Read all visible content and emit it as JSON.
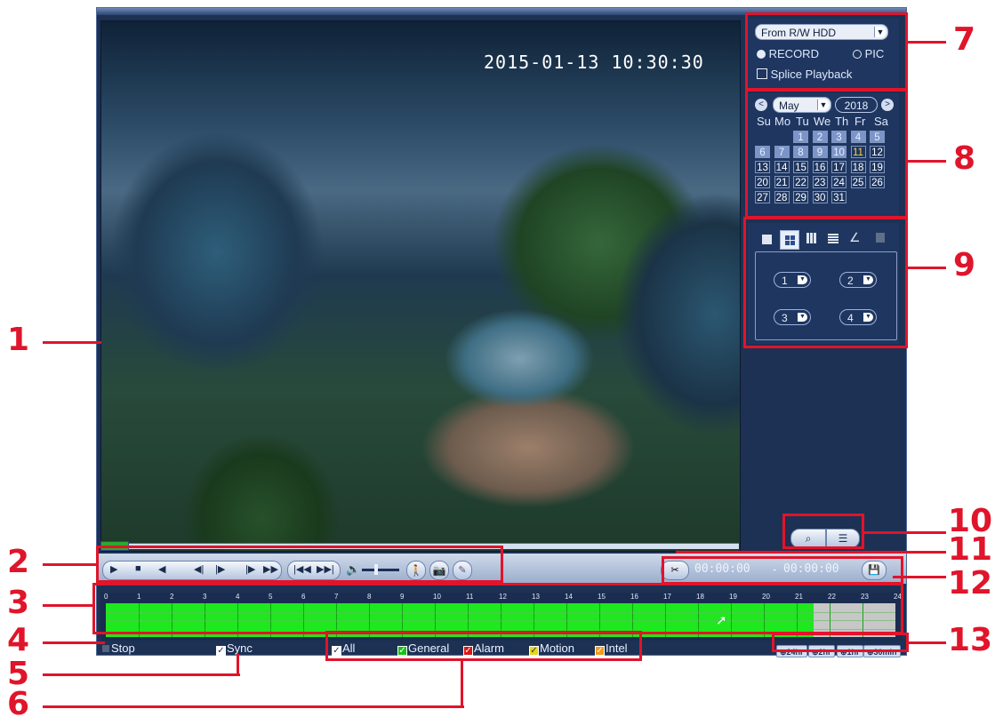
{
  "video": {
    "timestamp": "2015-01-13  10:30:30"
  },
  "source_panel": {
    "source_select": "From R/W HDD",
    "record_label": "RECORD",
    "pic_label": "PIC",
    "splice_label": "Splice Playback",
    "record_selected": true
  },
  "calendar": {
    "prev_icon": "<",
    "next_icon": ">",
    "month": "May",
    "year": "2018",
    "weekdays": [
      "Su",
      "Mo",
      "Tu",
      "We",
      "Th",
      "Fr",
      "Sa"
    ],
    "days": [
      "1",
      "2",
      "3",
      "4",
      "5",
      "6",
      "7",
      "8",
      "9",
      "10",
      "11",
      "12",
      "13",
      "14",
      "15",
      "16",
      "17",
      "18",
      "19",
      "20",
      "21",
      "22",
      "23",
      "24",
      "25",
      "26",
      "27",
      "28",
      "29",
      "30",
      "31"
    ],
    "recorded_days": [
      1,
      2,
      3,
      4,
      5,
      6,
      7,
      8,
      9,
      10
    ],
    "today": 11
  },
  "channel_panel": {
    "layout_icons": [
      "single-window-icon",
      "four-window-icon",
      "nine-window-icon",
      "sixteen-window-icon",
      "edit-icon",
      "delete-icon"
    ],
    "channels": [
      "1",
      "2",
      "3",
      "4"
    ]
  },
  "controls": {
    "icons": [
      "play-icon",
      "stop-icon",
      "reverse-play-icon",
      "frame-back-icon",
      "frame-forward-icon",
      "slow-play-icon",
      "fast-play-icon",
      "previous-day-icon",
      "next-day-icon",
      "volume-icon",
      "smart-search-icon",
      "snapshot-icon",
      "mark-icon"
    ],
    "clip_start": "00:00:00",
    "clip_separator": "-",
    "clip_end": "00:00:00"
  },
  "timeline": {
    "hours": [
      "0",
      "1",
      "2",
      "3",
      "4",
      "5",
      "6",
      "7",
      "8",
      "9",
      "10",
      "11",
      "12",
      "13",
      "14",
      "15",
      "16",
      "17",
      "18",
      "19",
      "20",
      "21",
      "22",
      "23",
      "24"
    ],
    "recorded_until_hour": 21.5
  },
  "bottom": {
    "stop_label": "Stop",
    "sync_label": "Sync",
    "all_label": "All",
    "general_label": "General",
    "alarm_label": "Alarm",
    "motion_label": "Motion",
    "intel_label": "Intel",
    "zoom_24hr": "24hr",
    "zoom_2hr": "2hr",
    "zoom_1hr": "1hr",
    "zoom_30min": "30min"
  },
  "colors": {
    "general": "#17c217",
    "alarm": "#d71818",
    "motion": "#e3d91e",
    "intel": "#f29b1c",
    "recorded": "#1ee81e",
    "callout": "#e0142a"
  },
  "callouts": {
    "n1": "1",
    "n2": "2",
    "n3": "3",
    "n4": "4",
    "n5": "5",
    "n6": "6",
    "n7": "7",
    "n8": "8",
    "n9": "9",
    "n10": "10",
    "n11": "11",
    "n12": "12",
    "n13": "13"
  }
}
